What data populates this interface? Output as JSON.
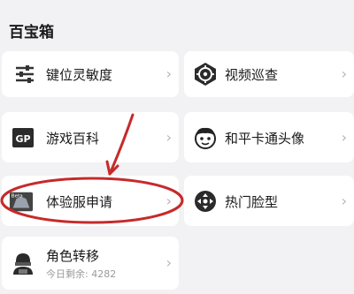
{
  "section": {
    "title": "百宝箱"
  },
  "items": [
    {
      "label": "键位灵敏度",
      "icon": "sliders-icon"
    },
    {
      "label": "视频巡查",
      "icon": "target-icon"
    },
    {
      "label": "游戏百科",
      "icon": "gp-book-icon"
    },
    {
      "label": "和平卡通头像",
      "icon": "cartoon-face-icon"
    },
    {
      "label": "体验服申请",
      "icon": "beta-server-icon",
      "badge": "Beta"
    },
    {
      "label": "热门脸型",
      "icon": "face-shape-icon"
    },
    {
      "label": "角色转移",
      "icon": "character-transfer-icon",
      "sub": "今日剩余: 4282"
    }
  ],
  "chevron": "›",
  "colors": {
    "annotation": "#c62a2a",
    "card": "#ffffff",
    "background": "#f2f2f4"
  }
}
